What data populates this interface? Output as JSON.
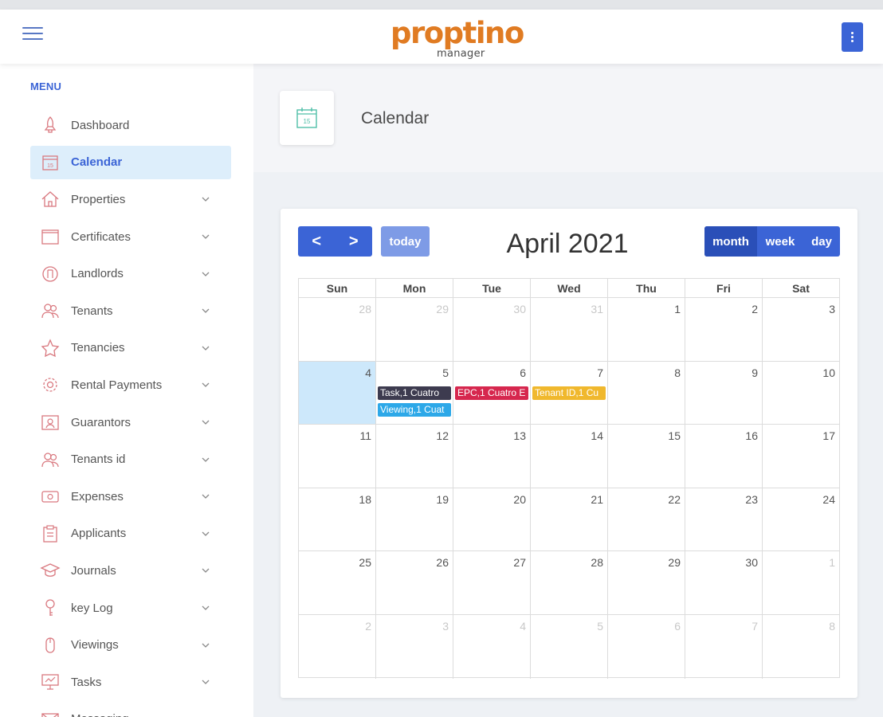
{
  "header": {
    "logo_text": "proptino",
    "logo_sub": "manager"
  },
  "sidebar": {
    "menu_title": "MENU",
    "items": [
      {
        "label": "Dashboard",
        "icon": "rocket-icon",
        "expandable": false,
        "active": false
      },
      {
        "label": "Calendar",
        "icon": "calendar-icon",
        "expandable": false,
        "active": true
      },
      {
        "label": "Properties",
        "icon": "house-icon",
        "expandable": true,
        "active": false
      },
      {
        "label": "Certificates",
        "icon": "certificate-icon",
        "expandable": true,
        "active": false
      },
      {
        "label": "Landlords",
        "icon": "landlord-icon",
        "expandable": true,
        "active": false
      },
      {
        "label": "Tenants",
        "icon": "users-icon",
        "expandable": true,
        "active": false
      },
      {
        "label": "Tenancies",
        "icon": "star-icon",
        "expandable": true,
        "active": false
      },
      {
        "label": "Rental Payments",
        "icon": "gear-icon",
        "expandable": true,
        "active": false
      },
      {
        "label": "Guarantors",
        "icon": "id-card-icon",
        "expandable": true,
        "active": false
      },
      {
        "label": "Tenants id",
        "icon": "users-icon",
        "expandable": true,
        "active": false
      },
      {
        "label": "Expenses",
        "icon": "money-icon",
        "expandable": true,
        "active": false
      },
      {
        "label": "Applicants",
        "icon": "clipboard-icon",
        "expandable": true,
        "active": false
      },
      {
        "label": "Journals",
        "icon": "graduation-cap-icon",
        "expandable": true,
        "active": false
      },
      {
        "label": "key Log",
        "icon": "key-icon",
        "expandable": true,
        "active": false
      },
      {
        "label": "Viewings",
        "icon": "mouse-icon",
        "expandable": true,
        "active": false
      },
      {
        "label": "Tasks",
        "icon": "presentation-icon",
        "expandable": true,
        "active": false
      },
      {
        "label": "Messaging",
        "icon": "envelope-icon",
        "expandable": true,
        "active": false
      }
    ]
  },
  "page": {
    "title": "Calendar",
    "icon_day": "15"
  },
  "calendar": {
    "title": "April 2021",
    "prev_label": "<",
    "next_label": ">",
    "today_label": "today",
    "views": [
      {
        "label": "month",
        "active": true
      },
      {
        "label": "week",
        "active": false
      },
      {
        "label": "day",
        "active": false
      }
    ],
    "weekdays": [
      "Sun",
      "Mon",
      "Tue",
      "Wed",
      "Thu",
      "Fri",
      "Sat"
    ],
    "weeks": [
      [
        {
          "d": "28",
          "other": true
        },
        {
          "d": "29",
          "other": true
        },
        {
          "d": "30",
          "other": true
        },
        {
          "d": "31",
          "other": true
        },
        {
          "d": "1"
        },
        {
          "d": "2"
        },
        {
          "d": "3"
        }
      ],
      [
        {
          "d": "4",
          "today": true
        },
        {
          "d": "5"
        },
        {
          "d": "6"
        },
        {
          "d": "7"
        },
        {
          "d": "8"
        },
        {
          "d": "9"
        },
        {
          "d": "10"
        }
      ],
      [
        {
          "d": "11"
        },
        {
          "d": "12"
        },
        {
          "d": "13"
        },
        {
          "d": "14"
        },
        {
          "d": "15"
        },
        {
          "d": "16"
        },
        {
          "d": "17"
        }
      ],
      [
        {
          "d": "18"
        },
        {
          "d": "19"
        },
        {
          "d": "20"
        },
        {
          "d": "21"
        },
        {
          "d": "22"
        },
        {
          "d": "23"
        },
        {
          "d": "24"
        }
      ],
      [
        {
          "d": "25"
        },
        {
          "d": "26"
        },
        {
          "d": "27"
        },
        {
          "d": "28"
        },
        {
          "d": "29"
        },
        {
          "d": "30"
        },
        {
          "d": "1",
          "other": true
        }
      ],
      [
        {
          "d": "2",
          "other": true
        },
        {
          "d": "3",
          "other": true
        },
        {
          "d": "4",
          "other": true
        },
        {
          "d": "5",
          "other": true
        },
        {
          "d": "6",
          "other": true
        },
        {
          "d": "7",
          "other": true
        },
        {
          "d": "8",
          "other": true
        }
      ]
    ],
    "events": [
      {
        "week": 1,
        "day": 1,
        "slot": 0,
        "label": "Task,1 Cuatro",
        "color": "#3d3b4f"
      },
      {
        "week": 1,
        "day": 1,
        "slot": 1,
        "label": "Viewing,1 Cuat",
        "color": "#2da8e8"
      },
      {
        "week": 1,
        "day": 2,
        "slot": 0,
        "label": "EPC,1 Cuatro E",
        "color": "#d6274e"
      },
      {
        "week": 1,
        "day": 3,
        "slot": 0,
        "label": "Tenant ID,1 Cu",
        "color": "#f0b82d"
      }
    ]
  },
  "colors": {
    "accent": "#3b64d6",
    "brand_orange": "#e07b22",
    "today_bg": "#cde8fb"
  }
}
